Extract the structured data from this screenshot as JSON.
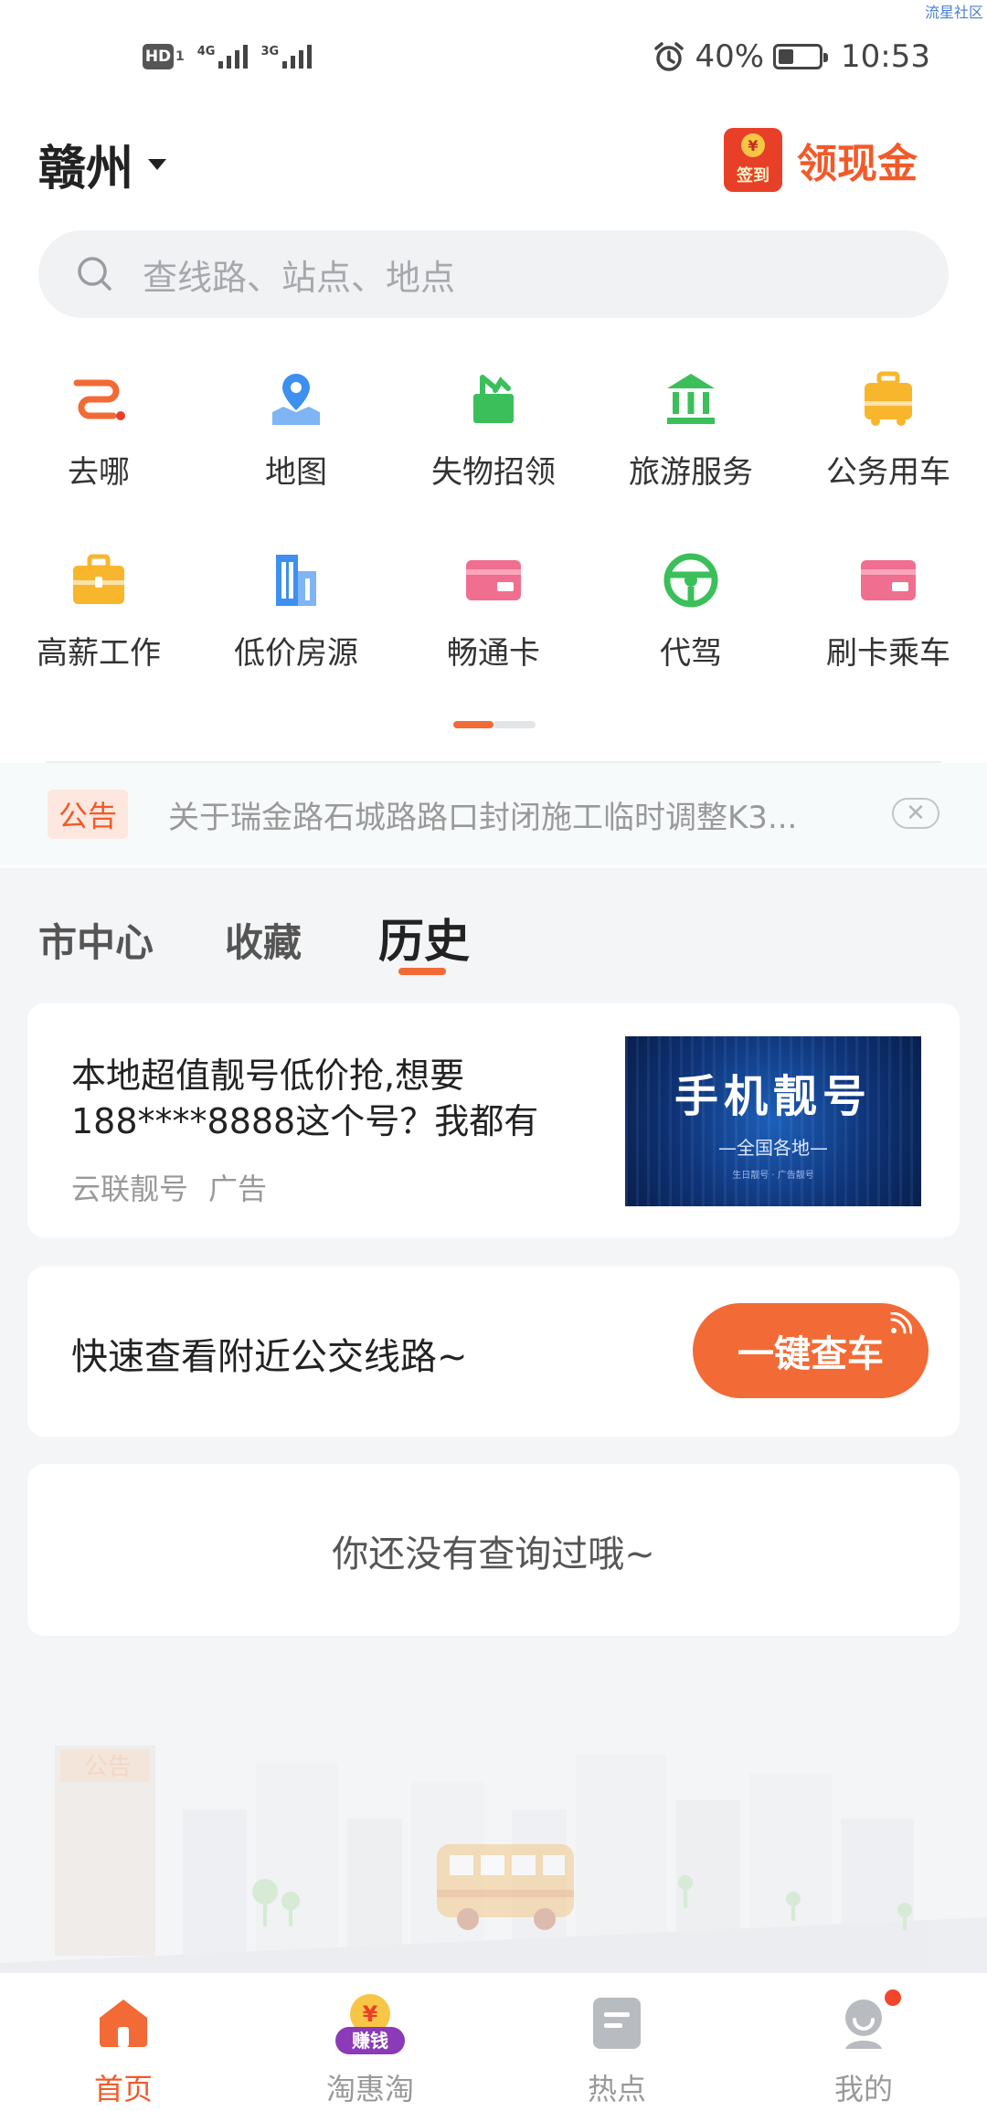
{
  "status_bar": {
    "watermark": "流星社区",
    "hd": "HD",
    "hd_sub": "1",
    "network1": "4G",
    "network2": "3G",
    "battery": "40%",
    "time": "10:53"
  },
  "header": {
    "city": "赣州",
    "cash_label": "领现金",
    "cash_icon_sign": "签到",
    "cash_icon_coin": "¥"
  },
  "search": {
    "placeholder": "查线路、站点、地点"
  },
  "grid": {
    "row1": [
      {
        "label": "去哪",
        "icon": "route-icon"
      },
      {
        "label": "地图",
        "icon": "map-pin-icon"
      },
      {
        "label": "失物招领",
        "icon": "lost-found-icon"
      },
      {
        "label": "旅游服务",
        "icon": "bank-icon"
      },
      {
        "label": "公务用车",
        "icon": "car-icon"
      }
    ],
    "row2": [
      {
        "label": "高薪工作",
        "icon": "briefcase-icon"
      },
      {
        "label": "低价房源",
        "icon": "building-icon"
      },
      {
        "label": "畅通卡",
        "icon": "card-icon"
      },
      {
        "label": "代驾",
        "icon": "steering-wheel-icon"
      },
      {
        "label": "刷卡乘车",
        "icon": "card-icon"
      }
    ]
  },
  "notice": {
    "tag": "公告",
    "text": "关于瑞金路石城路路口封闭施工临时调整K3..."
  },
  "tabs": [
    {
      "label": "市中心"
    },
    {
      "label": "收藏"
    },
    {
      "label": "历史",
      "active": true
    }
  ],
  "ad": {
    "title": "本地超值靓号低价抢,想要188****8888这个号？我都有",
    "source": "云联靓号",
    "badge": "广告",
    "image_title": "手机靓号",
    "image_sub": "—全国各地—",
    "image_tiny": "生日靓号 · 广告靓号"
  },
  "quick": {
    "text": "快速查看附近公交线路~",
    "button": "一键查车"
  },
  "empty": {
    "text": "你还没有查询过哦~"
  },
  "illustration": {
    "sign": "公告"
  },
  "bottom_nav": [
    {
      "label": "首页",
      "active": true
    },
    {
      "label": "淘惠淘",
      "badge": "赚钱",
      "coin": "¥"
    },
    {
      "label": "热点"
    },
    {
      "label": "我的"
    }
  ],
  "colors": {
    "accent": "#f26a35",
    "red": "#e84028",
    "blue": "#3d8ff0",
    "green": "#3bbf5a",
    "yellow": "#f8b62d",
    "pink": "#f06e8f"
  }
}
